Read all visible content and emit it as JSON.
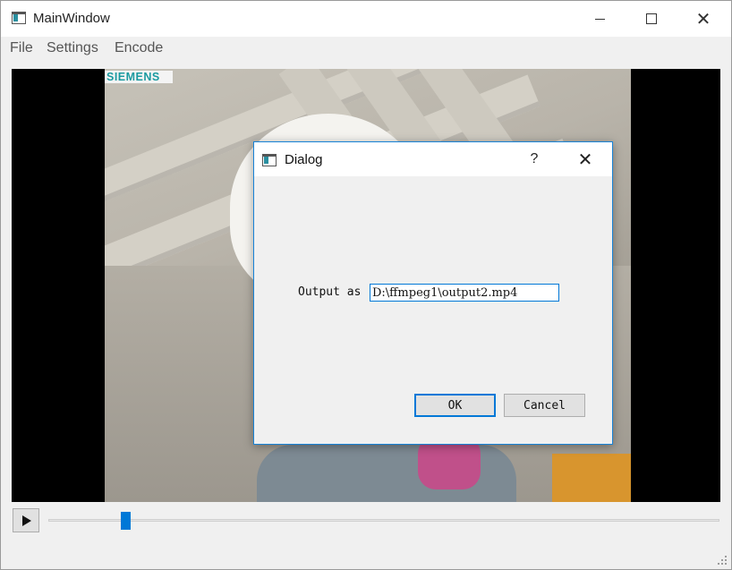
{
  "window": {
    "title": "MainWindow",
    "icons": {
      "app": "app-window-icon",
      "minimize": "minimize-icon",
      "maximize": "maximize-icon",
      "close": "close-icon"
    },
    "close_glyph": "✕"
  },
  "menu": {
    "items": [
      {
        "label": "File"
      },
      {
        "label": "Settings"
      },
      {
        "label": "Encode"
      }
    ]
  },
  "video": {
    "logo_text": "SIEMENS",
    "brand_color": "#1a9aa0"
  },
  "player": {
    "play_icon": "play-icon",
    "seek_position_fraction": 0.115,
    "accent_color": "#0078d7"
  },
  "dialog": {
    "title": "Dialog",
    "help_label": "?",
    "close_glyph": "✕",
    "output_label": "Output as",
    "output_value": "D:\\ffmpeg1\\output2.mp4",
    "ok_label": "OK",
    "cancel_label": "Cancel"
  }
}
